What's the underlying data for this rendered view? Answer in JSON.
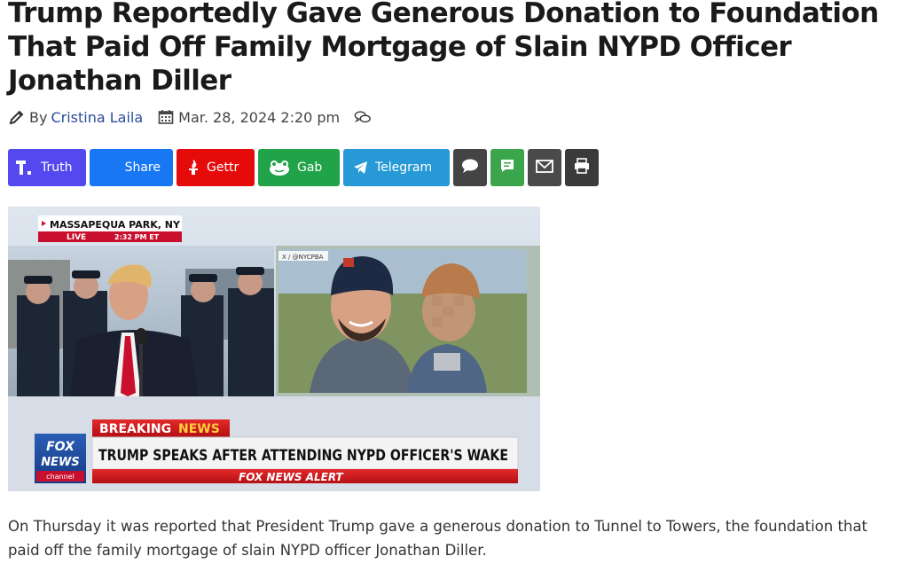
{
  "article": {
    "title": "Trump Reportedly Gave Generous Donation to Foundation That Paid Off Family Mortgage of Slain NYPD Officer Jonathan Diller",
    "by_label": "By",
    "author": "Cristina Laila",
    "date": "Mar. 28, 2024 2:20 pm",
    "body": "On Thursday it was reported that President Trump gave a generous donation to Tunnel to Towers, the foundation that paid off the family mortgage of slain NYPD officer Jonathan Diller."
  },
  "share_buttons": {
    "truth": "Truth",
    "share": "Share",
    "gettr": "Gettr",
    "gab": "Gab",
    "telegram": "Telegram"
  },
  "image": {
    "location": "MASSAPEQUA PARK, NY",
    "live": "LIVE",
    "time": "2:32 PM ET",
    "credit": "X / @NYCPBA",
    "breaking": "BREAKING",
    "news": "NEWS",
    "headline": "TRUMP SPEAKS AFTER ATTENDING NYPD OFFICER'S WAKE",
    "alert": "FOX NEWS ALERT",
    "logo_fox": "FOX",
    "logo_news": "NEWS",
    "logo_channel": "channel"
  },
  "colors": {
    "truth": "#5448ee",
    "facebook": "#1877f2",
    "gettr": "#e60b0b",
    "gab": "#21a34a",
    "telegram": "#2699d6",
    "author_link": "#2b4c9b",
    "breaking_red": "#d0141a"
  },
  "icons": [
    "pencil-icon",
    "calendar-icon",
    "comments-icon",
    "truth-icon",
    "facebook-icon",
    "gettr-icon",
    "gab-icon",
    "telegram-icon",
    "comment-icon",
    "sms-icon",
    "email-icon",
    "print-icon"
  ]
}
